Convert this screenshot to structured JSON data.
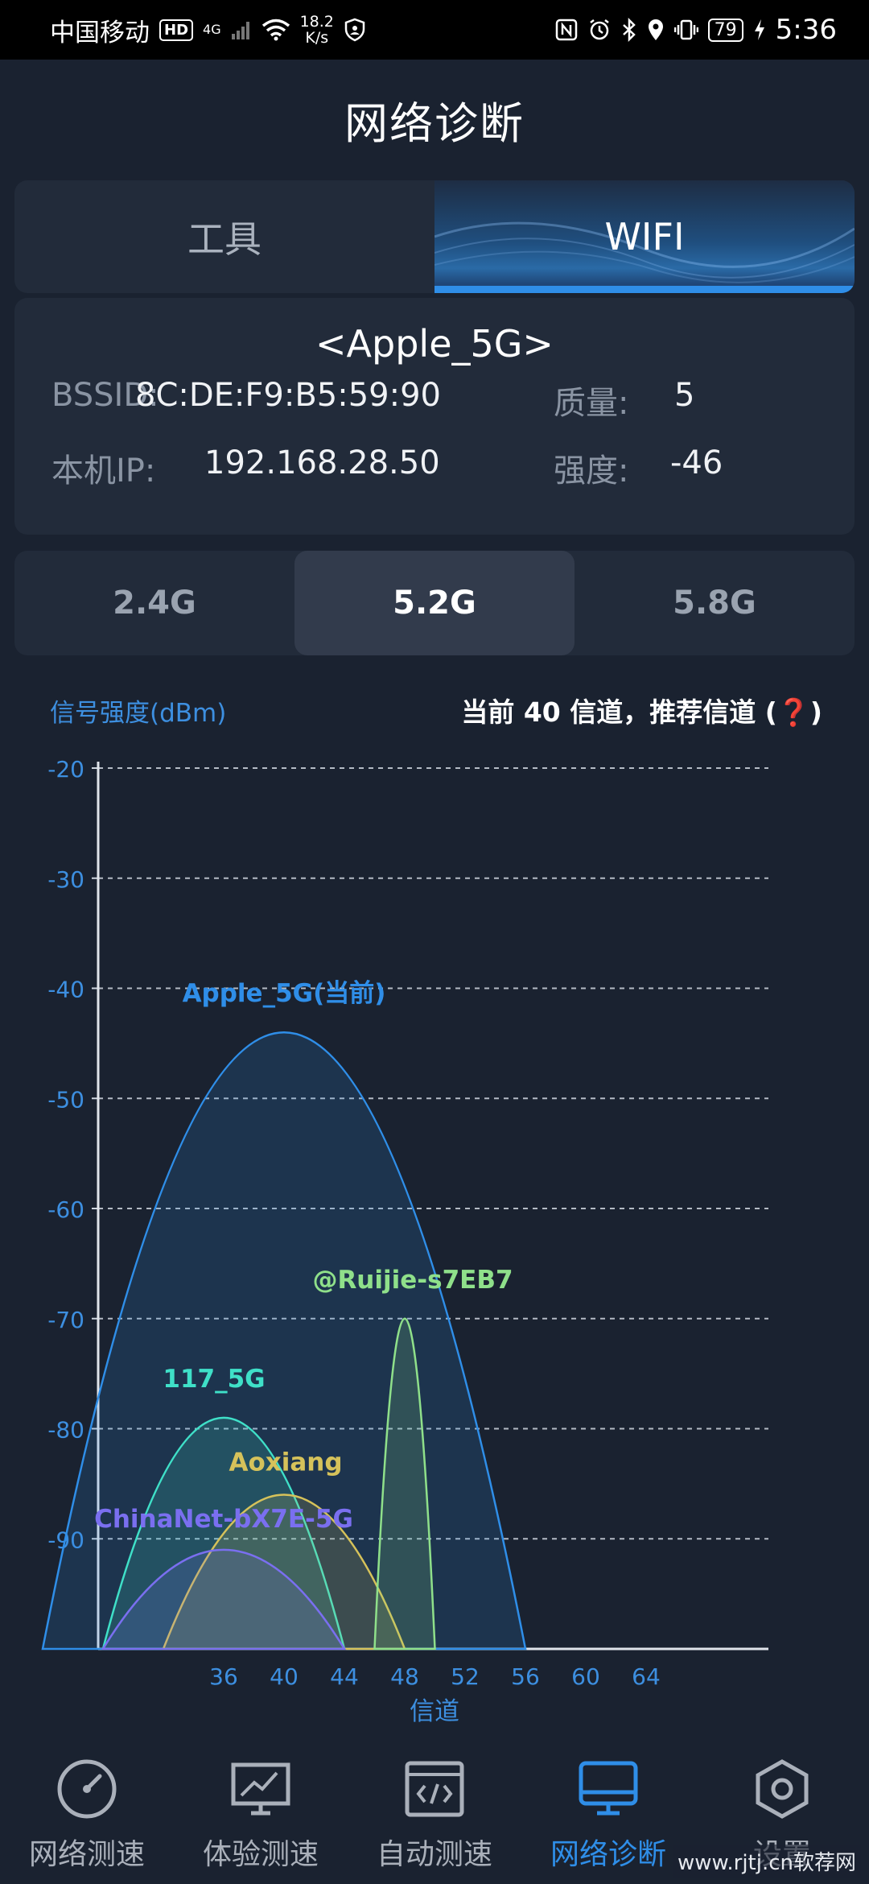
{
  "status_bar": {
    "carrier": "中国移动",
    "hd": "HD",
    "network": "4G",
    "speed_value": "18.2",
    "speed_unit": "K/s",
    "battery": "79",
    "time": "5:36"
  },
  "page_title": "网络诊断",
  "top_tabs": [
    {
      "label": "工具",
      "active": false
    },
    {
      "label": "WIFI",
      "active": true
    }
  ],
  "wifi_info": {
    "ssid": "<Apple_5G>",
    "bssid_label": "BSSID:",
    "bssid_value": "8C:DE:F9:B5:59:90",
    "quality_label": "质量:",
    "quality_value": "5",
    "ip_label": "本机IP:",
    "ip_value": "192.168.28.50",
    "strength_label": "强度:",
    "strength_value": "-46"
  },
  "band_tabs": [
    {
      "label": "2.4G",
      "active": false
    },
    {
      "label": "5.2G",
      "active": true
    },
    {
      "label": "5.8G",
      "active": false
    }
  ],
  "chart_header": {
    "ylabel": "信号强度(dBm)",
    "channel_info": "当前 40 信道，推荐信道 (",
    "help_glyph": "❓",
    "channel_info_end": ")"
  },
  "chart_data": {
    "type": "area",
    "ylabel": "信号强度(dBm)",
    "xlabel": "信道",
    "ylim": [
      -100,
      -20
    ],
    "yticks": [
      -20,
      -30,
      -40,
      -50,
      -60,
      -70,
      -80,
      -90
    ],
    "xticks": [
      36,
      40,
      44,
      48,
      52,
      56,
      60,
      64
    ],
    "grid": true,
    "series": [
      {
        "name": "Apple_5G(当前)",
        "center": 40,
        "x_start": 24,
        "x_end": 56,
        "peak": -44,
        "color": "#2f8ee8"
      },
      {
        "name": "117_5G",
        "center": 36,
        "x_start": 28,
        "x_end": 44,
        "peak": -79,
        "color": "#3fe0c8"
      },
      {
        "name": "Aoxiang",
        "center": 40,
        "x_start": 32,
        "x_end": 48,
        "peak": -86,
        "color": "#d6c25a"
      },
      {
        "name": "ChinaNet-bX7E-5G",
        "center": 36,
        "x_start": 28,
        "x_end": 44,
        "peak": -91,
        "color": "#7a6ff0"
      },
      {
        "name": "@Ruijie-s7EB7",
        "center": 48,
        "x_start": 46,
        "x_end": 50,
        "peak": -70,
        "color": "#8fe08a"
      }
    ]
  },
  "bottom_nav": [
    {
      "label": "网络测速",
      "icon": "speedometer-icon",
      "active": false
    },
    {
      "label": "体验测速",
      "icon": "chart-monitor-icon",
      "active": false
    },
    {
      "label": "自动测速",
      "icon": "code-window-icon",
      "active": false
    },
    {
      "label": "网络诊断",
      "icon": "monitor-icon",
      "active": true
    },
    {
      "label": "设置",
      "icon": "hexagon-gear-icon",
      "active": false
    }
  ],
  "watermark": "www.rjtj.cn软荐网",
  "colors": {
    "background": "#1a2230",
    "card": "#222b3a",
    "accent": "#2f8ee8"
  }
}
